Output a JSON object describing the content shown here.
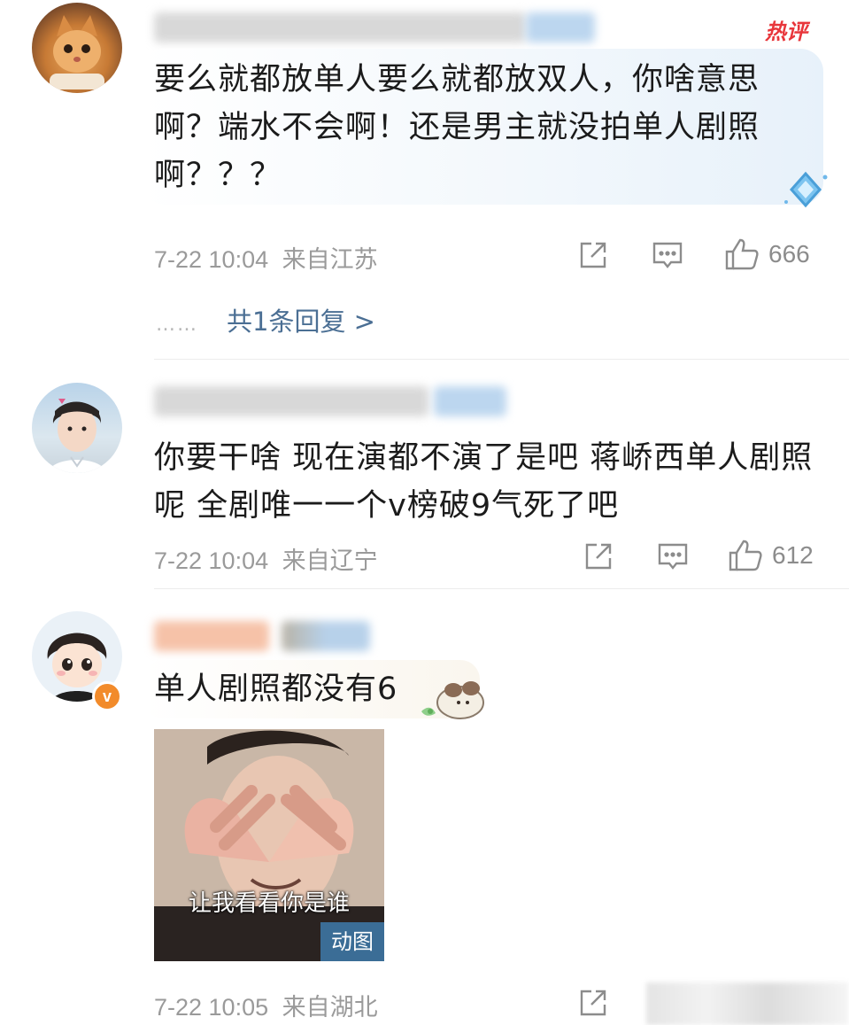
{
  "comments": [
    {
      "badge": "热评",
      "text_lines": [
        "要么就都放单人要么就都放双人，你啥意思",
        "啊？端水不会啊！还是男主就没拍单人剧照",
        "啊？？？"
      ],
      "time": "7-22 10:04",
      "location": "来自江苏",
      "likes": "666",
      "replies_label": "共1条回复 >"
    },
    {
      "text_lines": [
        "你要干啥 现在演都不演了是吧 蒋峤西单人剧照",
        "呢 全剧唯一一个v榜破9气死了吧"
      ],
      "time": "7-22 10:04",
      "location": "来自辽宁",
      "likes": "612"
    },
    {
      "text_lines": [
        "单人剧照都没有6"
      ],
      "image_caption": "让我看看你是谁",
      "image_tag": "动图",
      "time": "7-22 10:05",
      "location": "来自湖北"
    }
  ],
  "icons": [
    "share-icon",
    "comment-icon",
    "like-icon",
    "verified-v-icon",
    "diamond-badge-icon"
  ],
  "colors": {
    "badge_red": "#e8363b",
    "reply_blue": "#4b6f94",
    "meta_gray": "#9a9a9a"
  }
}
